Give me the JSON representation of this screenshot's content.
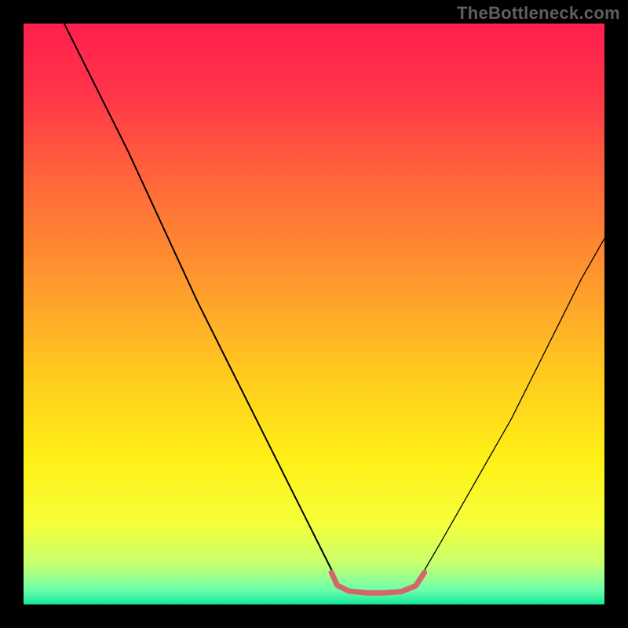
{
  "watermark": "TheBottleneck.com",
  "chart_data": {
    "type": "line",
    "title": "",
    "xlabel": "",
    "ylabel": "",
    "xlim": [
      0,
      100
    ],
    "ylim": [
      0,
      100
    ],
    "grid": false,
    "legend": false,
    "annotations": [],
    "series": [
      {
        "name": "curve-left",
        "stroke": "#000000",
        "stroke_width": 2,
        "points": [
          {
            "x": 7.0,
            "y": 100.0
          },
          {
            "x": 12.0,
            "y": 90.0
          },
          {
            "x": 18.0,
            "y": 78.0
          },
          {
            "x": 24.0,
            "y": 65.0
          },
          {
            "x": 30.0,
            "y": 52.0
          },
          {
            "x": 36.0,
            "y": 40.0
          },
          {
            "x": 42.0,
            "y": 28.0
          },
          {
            "x": 47.0,
            "y": 18.0
          },
          {
            "x": 51.0,
            "y": 10.0
          },
          {
            "x": 53.5,
            "y": 5.0
          }
        ]
      },
      {
        "name": "curve-right",
        "stroke": "#000000",
        "stroke_width": 1.3,
        "points": [
          {
            "x": 68.5,
            "y": 5.0
          },
          {
            "x": 72.0,
            "y": 11.0
          },
          {
            "x": 76.0,
            "y": 18.0
          },
          {
            "x": 80.0,
            "y": 25.0
          },
          {
            "x": 84.0,
            "y": 32.0
          },
          {
            "x": 88.0,
            "y": 40.0
          },
          {
            "x": 92.0,
            "y": 48.0
          },
          {
            "x": 96.0,
            "y": 56.0
          },
          {
            "x": 100.0,
            "y": 63.0
          }
        ]
      },
      {
        "name": "floor-marker",
        "stroke": "#d5666a",
        "stroke_width": 7,
        "linecap": "round",
        "points": [
          {
            "x": 53.0,
            "y": 5.5
          },
          {
            "x": 54.0,
            "y": 3.3
          },
          {
            "x": 56.0,
            "y": 2.3
          },
          {
            "x": 59.0,
            "y": 2.0
          },
          {
            "x": 62.0,
            "y": 2.0
          },
          {
            "x": 65.0,
            "y": 2.2
          },
          {
            "x": 67.5,
            "y": 3.2
          },
          {
            "x": 69.0,
            "y": 5.5
          }
        ]
      }
    ],
    "background_gradient": {
      "type": "vertical",
      "stops": [
        {
          "offset": 0.0,
          "color": "#ff1f4d"
        },
        {
          "offset": 0.12,
          "color": "#ff3549"
        },
        {
          "offset": 0.28,
          "color": "#ff6a3a"
        },
        {
          "offset": 0.45,
          "color": "#ff9a2d"
        },
        {
          "offset": 0.6,
          "color": "#ffc91f"
        },
        {
          "offset": 0.75,
          "color": "#fff016"
        },
        {
          "offset": 0.86,
          "color": "#f6ff3a"
        },
        {
          "offset": 0.93,
          "color": "#c7ff6e"
        },
        {
          "offset": 0.975,
          "color": "#6dffab"
        },
        {
          "offset": 1.0,
          "color": "#14e89b"
        }
      ]
    }
  }
}
